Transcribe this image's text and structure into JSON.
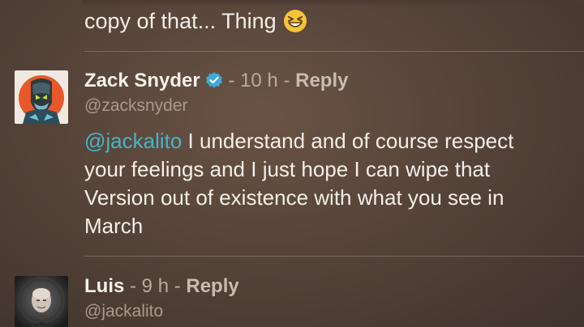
{
  "previous_comment": {
    "text": "copy of that... Thing",
    "emoji": "grinning-squinting-face"
  },
  "comments": [
    {
      "author": "Zack Snyder",
      "verified": true,
      "separator": " - ",
      "time": "10 h",
      "reply_label": "Reply",
      "handle": "@zacksnyder",
      "mention": "@jackalito",
      "text": " I understand and of course respect your feelings and I just hope I can wipe that Version out of existence with what you see in March"
    },
    {
      "author": "Luis",
      "verified": false,
      "separator": " - ",
      "time": "9 h",
      "reply_label": "Reply",
      "handle": "@jackalito"
    }
  ],
  "colors": {
    "mention": "#45b5c8",
    "verified_badge": "#3fa9d6",
    "background": "#56443a"
  }
}
